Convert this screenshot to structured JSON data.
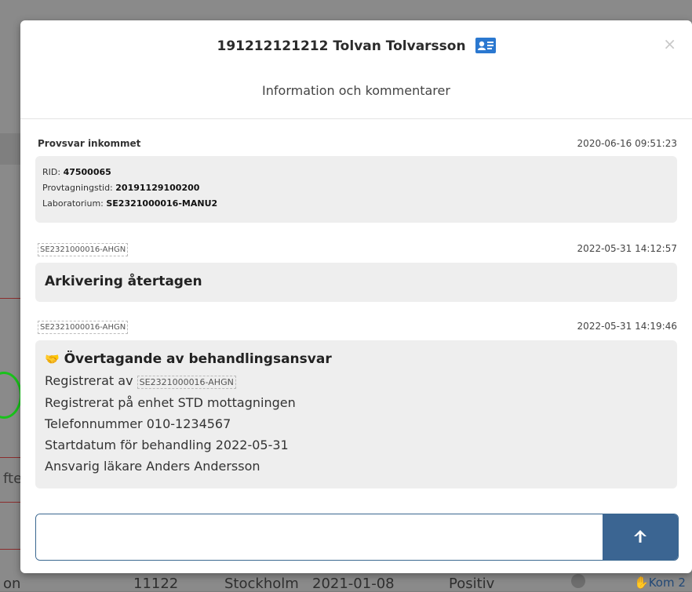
{
  "background": {
    "left_fragment_1": "?",
    "left_fragment_2": "fte",
    "row_cells": [
      "on",
      "11122",
      "Stockholm",
      "2021-01-08",
      "Positiv",
      "Kom 2"
    ]
  },
  "modal": {
    "patient_title": "191212121212 Tolvan Tolvarsson",
    "id_card_icon": "id-card-icon",
    "close_label": "×",
    "subtitle": "Information och kommentarer"
  },
  "entries": [
    {
      "label": "Provsvar inkommet",
      "timestamp": "2020-06-16 09:51:23",
      "lines": [
        {
          "key": "RID: ",
          "value": "47500065"
        },
        {
          "key": "Provtagningstid: ",
          "value": "20191129100200"
        },
        {
          "key": "Laboratorium: ",
          "value": "SE2321000016-MANU2"
        }
      ]
    },
    {
      "tag": "SE2321000016-AHGN",
      "timestamp": "2022-05-31 14:12:57",
      "title": "Arkivering återtagen"
    },
    {
      "tag": "SE2321000016-AHGN",
      "timestamp": "2022-05-31 14:19:46",
      "title": "Övertagande av behandlingsansvar",
      "registered_by_label": "Registrerat av",
      "registered_by_tag": "SE2321000016-AHGN",
      "lines": [
        "Registrerat på enhet STD mottagningen",
        "Telefonnummer 010-1234567",
        "Startdatum för behandling 2022-05-31",
        "Ansvarig läkare Anders Andersson"
      ]
    }
  ],
  "comment_input": {
    "value": "",
    "placeholder": ""
  },
  "send_icon": "arrow-up-icon",
  "colors": {
    "accent": "#3b6592",
    "card_bg": "#eeeeee"
  }
}
